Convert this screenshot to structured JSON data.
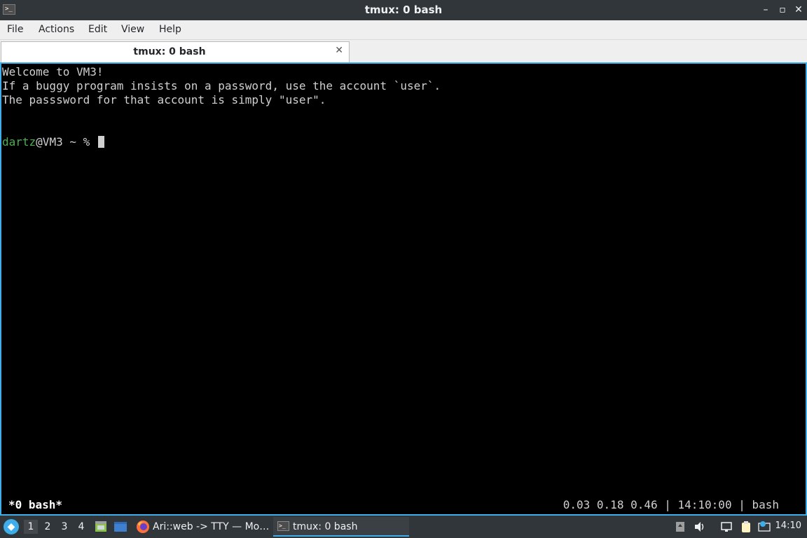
{
  "window": {
    "title": "tmux: 0 bash",
    "app_icon_glyph": ">_",
    "controls": {
      "minimize": "–",
      "restore": "▫",
      "close": "✕"
    }
  },
  "menu": {
    "items": [
      "File",
      "Actions",
      "Edit",
      "View",
      "Help"
    ]
  },
  "tab": {
    "label": "tmux: 0 bash",
    "close_glyph": "✕"
  },
  "terminal": {
    "lines": [
      "Welcome to VM3!",
      "If a buggy program insists on a password, use the account `user`.",
      "The passsword for that account is simply \"user\"."
    ],
    "prompt": {
      "user": "dartz",
      "host_rest": "@VM3 ~ % "
    },
    "colors": {
      "background": "#000000",
      "text": "#d0d0d0",
      "user": "#4caf50",
      "focus_border": "#3daee9"
    }
  },
  "tmux_status": {
    "left": "*0 bash*",
    "right": "0.03 0.18 0.46 | 14:10:00 | bash"
  },
  "taskbar": {
    "start_icon": "start-menu-icon",
    "desktops": [
      "1",
      "2",
      "3",
      "4"
    ],
    "active_desktop": "1",
    "launchers": [
      "file-manager-icon",
      "show-desktop-icon"
    ],
    "tasks": [
      {
        "label": "Ari::web -> TTY — Mo…",
        "icon": "firefox-icon",
        "active": false
      },
      {
        "label": "tmux: 0 bash",
        "icon": "terminal-icon",
        "active": true
      }
    ],
    "tray": [
      "removable-media-icon",
      "volume-icon",
      "network-icon",
      "clipboard-icon",
      "notification-icon"
    ],
    "clock": "14:10"
  }
}
